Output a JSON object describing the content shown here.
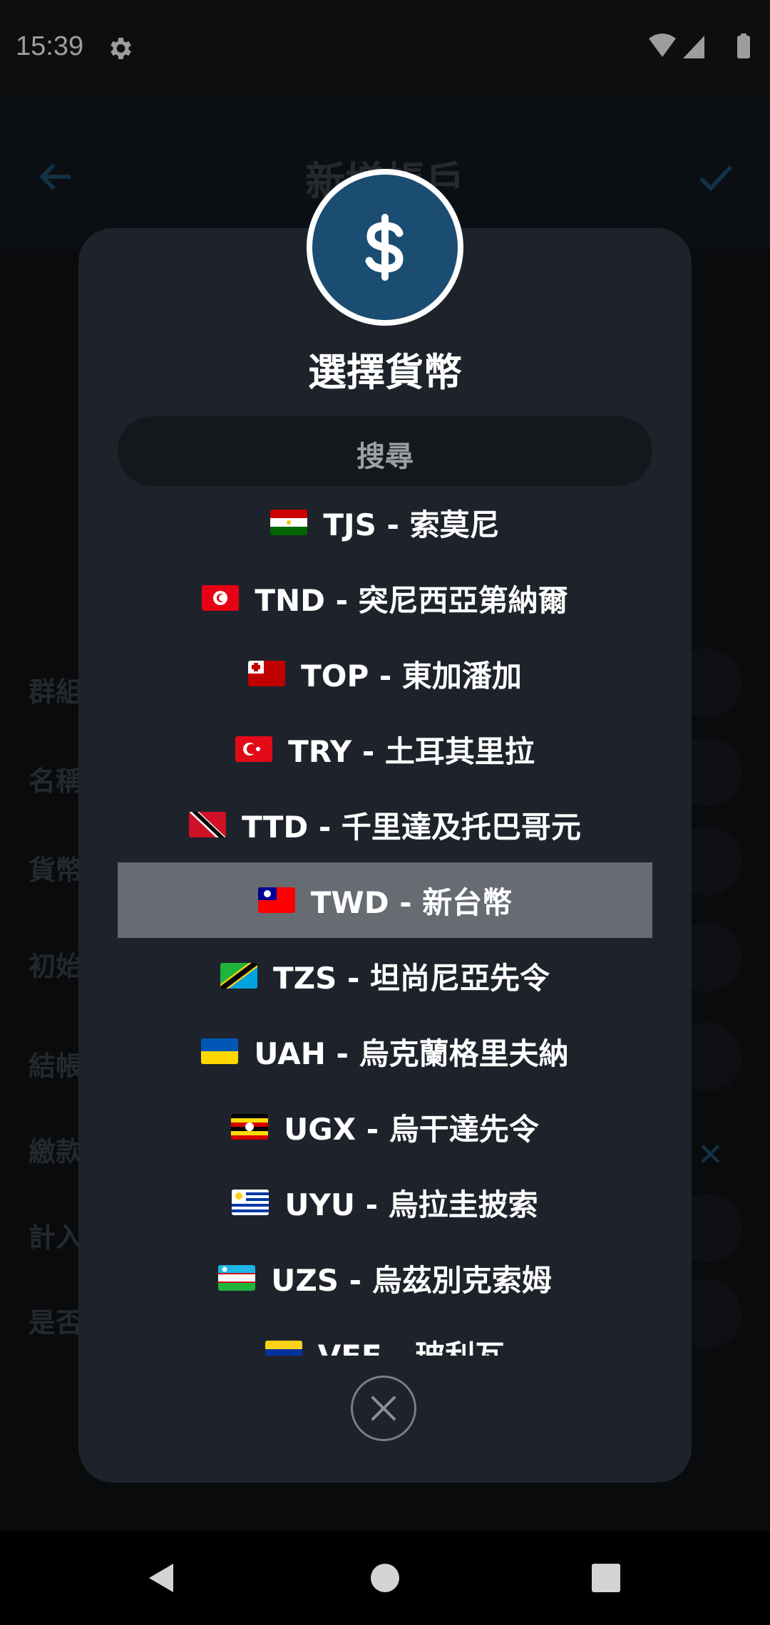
{
  "status_bar": {
    "time": "15:39"
  },
  "background_app": {
    "title": "新增帳戶",
    "labels": [
      "群組",
      "名稱",
      "貨幣",
      "初始",
      "結帳",
      "繳款",
      "計入",
      "是否"
    ]
  },
  "dialog": {
    "title": "選擇貨幣",
    "badge_icon": "dollar-icon",
    "search_placeholder": "搜尋",
    "currencies": [
      {
        "code": "TJS",
        "label": "TJS - 索莫尼",
        "flag": "TJ"
      },
      {
        "code": "TND",
        "label": "TND - 突尼西亞第納爾",
        "flag": "TN"
      },
      {
        "code": "TOP",
        "label": "TOP - 東加潘加",
        "flag": "TO"
      },
      {
        "code": "TRY",
        "label": "TRY - 土耳其里拉",
        "flag": "TR"
      },
      {
        "code": "TTD",
        "label": "TTD - 千里達及托巴哥元",
        "flag": "TT"
      },
      {
        "code": "TWD",
        "label": "TWD - 新台幣",
        "flag": "TW",
        "selected": true
      },
      {
        "code": "TZS",
        "label": "TZS - 坦尚尼亞先令",
        "flag": "TZ"
      },
      {
        "code": "UAH",
        "label": "UAH - 烏克蘭格里夫納",
        "flag": "UA"
      },
      {
        "code": "UGX",
        "label": "UGX - 烏干達先令",
        "flag": "UG"
      },
      {
        "code": "UYU",
        "label": "UYU - 烏拉圭披索",
        "flag": "UY"
      },
      {
        "code": "UZS",
        "label": "UZS - 烏茲別克索姆",
        "flag": "UZ"
      },
      {
        "code": "VEF",
        "label": "VEF - 玻利瓦",
        "flag": "VE"
      }
    ],
    "close_icon": "close-icon"
  },
  "colors": {
    "selected_row": "#676c73",
    "badge": "#1b4d72",
    "dialog_bg": "#1e232b"
  }
}
